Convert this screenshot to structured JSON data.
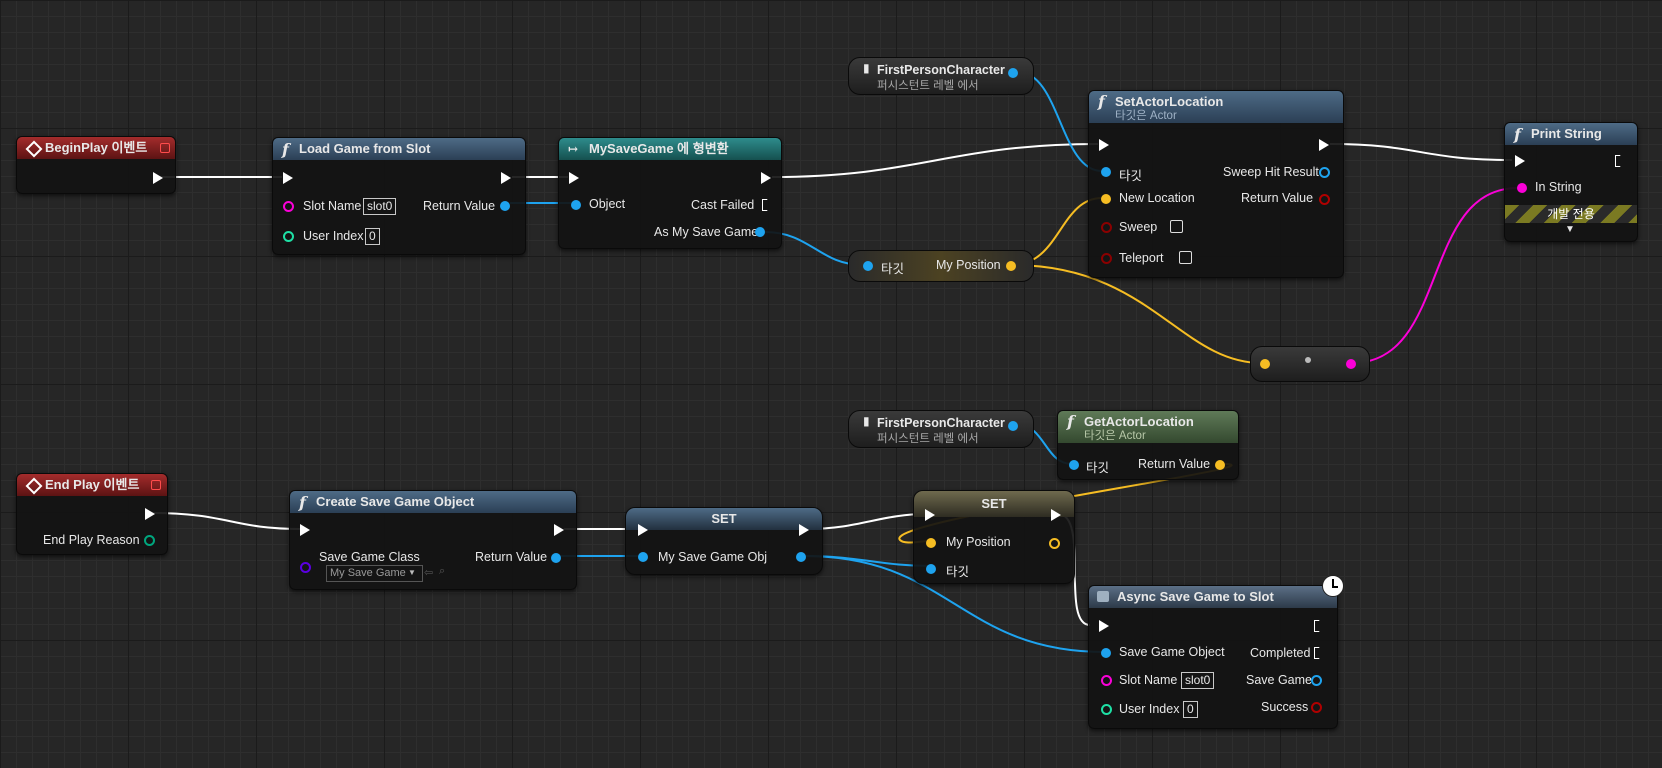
{
  "colors": {
    "exec": "#ffffff",
    "object": "#1ea3ef",
    "struct": "#f6bd23",
    "string": "#fb00d8",
    "integer": "#1ee0a5",
    "bool": "#8b0000",
    "class": "#5a00e0"
  },
  "nodes": {
    "begin_play": {
      "title": "BeginPlay 이벤트"
    },
    "load_game": {
      "title": "Load Game from Slot",
      "slot_name_label": "Slot Name",
      "slot_name_value": "slot0",
      "user_index_label": "User Index",
      "user_index_value": "0",
      "return_label": "Return Value"
    },
    "cast": {
      "title": "MySaveGame 에 형변환",
      "object_label": "Object",
      "cast_failed_label": "Cast Failed",
      "as_label": "As My Save Game"
    },
    "fpc_top": {
      "title": "FirstPersonCharacter",
      "subtitle": "퍼시스턴트 레벨 에서"
    },
    "get_pos": {
      "target_label": "타깃",
      "out_label": "My Position"
    },
    "set_actor_location": {
      "title": "SetActorLocation",
      "subtitle": "타깃은 Actor",
      "target_label": "타깃",
      "sweep_hit_label": "Sweep Hit Result",
      "new_location_label": "New Location",
      "return_label": "Return Value",
      "sweep_label": "Sweep",
      "teleport_label": "Teleport"
    },
    "print_string": {
      "title": "Print String",
      "in_string_label": "In String",
      "dev_label": "개발 전용"
    },
    "end_play": {
      "title": "End Play 이벤트",
      "reason_label": "End Play Reason"
    },
    "create_save": {
      "title": "Create Save Game Object",
      "class_label": "Save Game Class",
      "class_value": "My Save Game",
      "return_label": "Return Value"
    },
    "set_obj": {
      "title": "SET",
      "pin_label": "My Save Game Obj"
    },
    "fpc_bottom": {
      "title": "FirstPersonCharacter",
      "subtitle": "퍼시스턴트 레벨 에서"
    },
    "get_actor_location": {
      "title": "GetActorLocation",
      "subtitle": "타깃은 Actor",
      "target_label": "타깃",
      "return_label": "Return Value"
    },
    "set_pos": {
      "title": "SET",
      "pos_label": "My Position",
      "target_label": "타깃"
    },
    "async_save": {
      "title": "Async Save Game to Slot",
      "object_label": "Save Game Object",
      "completed_label": "Completed",
      "slot_name_label": "Slot Name",
      "slot_name_value": "slot0",
      "save_game_label": "Save Game",
      "user_index_label": "User Index",
      "user_index_value": "0",
      "success_label": "Success"
    }
  }
}
